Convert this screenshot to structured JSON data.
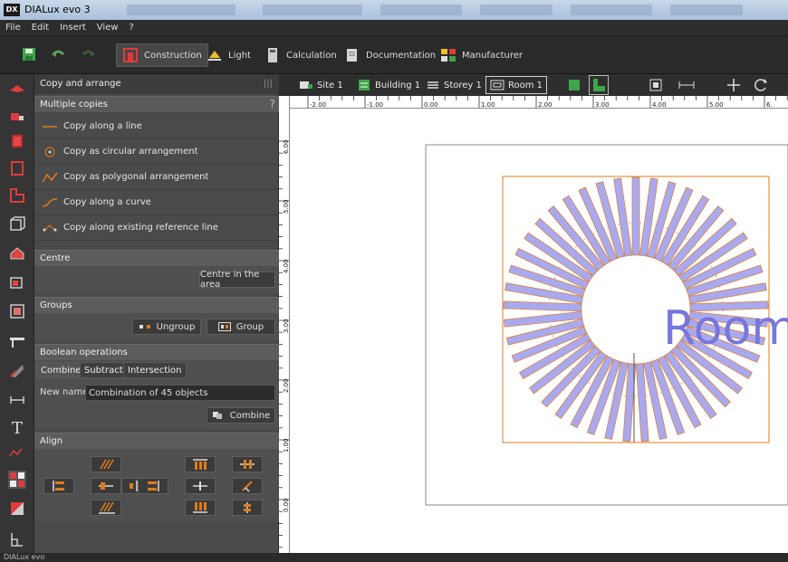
{
  "window": {
    "app_icon": "DX",
    "title": "DIALux evo 3"
  },
  "menu": [
    "File",
    "Edit",
    "Insert",
    "View",
    "?"
  ],
  "toolbar": {
    "tabs": [
      {
        "label": "Construction",
        "icon": "construction-icon",
        "active": true
      },
      {
        "label": "Light",
        "icon": "lamp-icon",
        "active": false
      },
      {
        "label": "Calculation",
        "icon": "calculator-icon",
        "active": false
      },
      {
        "label": "Documentation",
        "icon": "document-icon",
        "active": false
      },
      {
        "label": "Manufacturer",
        "icon": "catalog-icon",
        "active": false
      }
    ]
  },
  "panel": {
    "title": "Copy and arrange",
    "multiple_copies": {
      "title": "Multiple copies",
      "help": "?",
      "items": [
        "Copy along a line",
        "Copy as circular arrangement",
        "Copy as polygonal arrangement",
        "Copy along a curve",
        "Copy along existing reference line"
      ]
    },
    "centre": {
      "title": "Centre",
      "button": "Centre in the area"
    },
    "groups": {
      "title": "Groups",
      "ungroup": "Ungroup",
      "group": "Group"
    },
    "boolean": {
      "title": "Boolean operations",
      "tabs": [
        "Combine",
        "Subtract",
        "Intersection"
      ],
      "new_name_label": "New name",
      "new_name_value": "Combination of 45 objects",
      "combine_button": "Combine"
    },
    "align": {
      "title": "Align"
    }
  },
  "breadcrumbs": [
    "Site 1",
    "Building 1",
    "Storey 1",
    "Room 1"
  ],
  "ruler": {
    "x_labels": [
      "-2.00",
      "-1.00",
      "0.00",
      "1.00",
      "2.00",
      "3.00",
      "4.00",
      "5.00",
      "6."
    ],
    "y_labels": [
      "6.00",
      "5.00",
      "4.00",
      "3.00",
      "2.00",
      "1.00",
      "0.00"
    ]
  },
  "canvas": {
    "room_label": "Room",
    "luminaire_count": 45
  },
  "status": "DIALux evo",
  "colors": {
    "accent_orange": "#e07b1d",
    "luminaire_fill": "#a9a9f0",
    "room_text": "#7777dd"
  }
}
